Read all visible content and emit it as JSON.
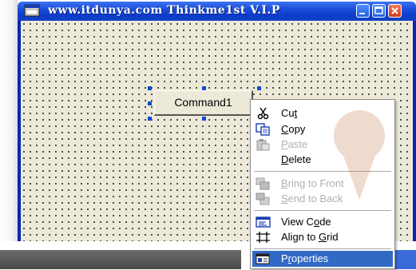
{
  "window": {
    "title": "www.itdunya.com Thinkme1st V.I.P"
  },
  "form": {
    "command_button_label": "Command1"
  },
  "context_menu": {
    "items": [
      {
        "label": "Cut",
        "icon": "scissors-icon",
        "enabled": true,
        "accel": "t"
      },
      {
        "label": "Copy",
        "icon": "copy-icon",
        "enabled": true,
        "accel": "C"
      },
      {
        "label": "Paste",
        "icon": "paste-icon",
        "enabled": false,
        "accel": "P"
      },
      {
        "label": "Delete",
        "icon": "",
        "enabled": true,
        "accel": "D"
      },
      {
        "label": "Bring to Front",
        "icon": "bring-to-front-icon",
        "enabled": false,
        "accel": "B"
      },
      {
        "label": "Send to Back",
        "icon": "send-to-back-icon",
        "enabled": false,
        "accel": "S"
      },
      {
        "label": "View Code",
        "icon": "view-code-icon",
        "enabled": true,
        "accel": "o"
      },
      {
        "label": "Align to Grid",
        "icon": "align-to-grid-icon",
        "enabled": true,
        "accel": "G"
      },
      {
        "label": "Properties",
        "icon": "properties-icon",
        "enabled": true,
        "accel": "r",
        "selected": true
      }
    ]
  },
  "colors": {
    "titlebar": "#0d3ccc",
    "form_background": "#ece9d8",
    "selection": "#316ac5",
    "handle": "#0a4fd0"
  }
}
